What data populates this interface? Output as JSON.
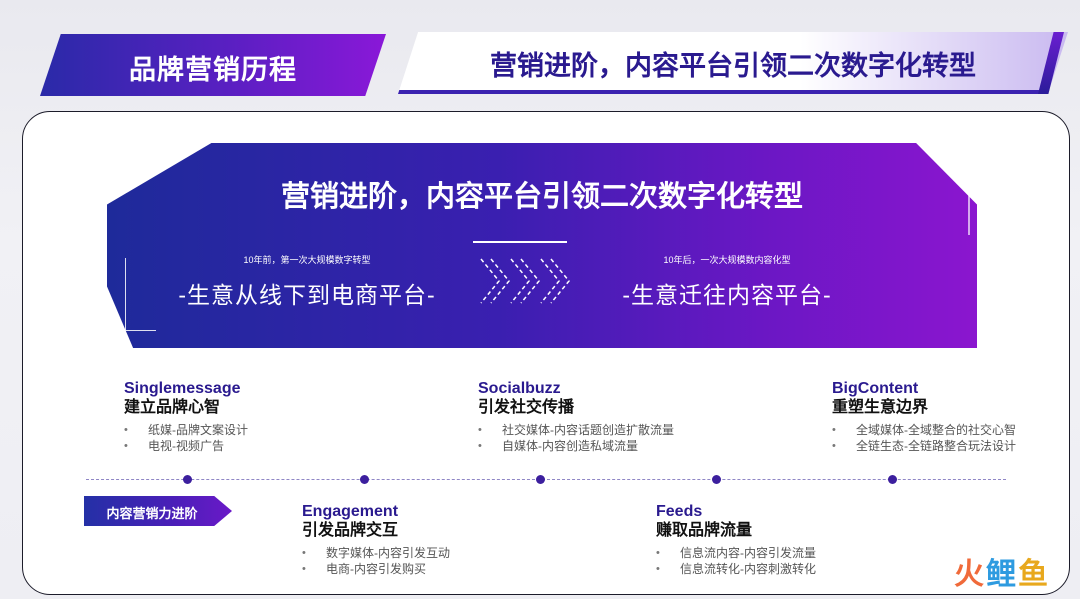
{
  "header": {
    "left_title": "品牌营销历程",
    "right_title": "营销进阶，内容平台引领二次数字化转型"
  },
  "hero": {
    "title": "营销进阶，内容平台引领二次数字化转型",
    "left_caption": "10年前，第一次大规模数字转型",
    "left_text": "-生意从线下到电商平台-",
    "right_caption": "10年后，一次大规模数内容化型",
    "right_text": "-生意迁往内容平台-"
  },
  "stages_top": [
    {
      "en": "Singlemessage",
      "zh": "建立品牌心智",
      "bullets": [
        "纸媒-品牌文案设计",
        "电视-视频广告"
      ]
    },
    {
      "en": "Socialbuzz",
      "zh": "引发社交传播",
      "bullets": [
        "社交媒体-内容话题创造扩散流量",
        "自媒体-内容创造私域流量"
      ]
    },
    {
      "en": "BigContent",
      "zh": "重塑生意边界",
      "bullets": [
        "全域媒体-全域整合的社交心智",
        "全链生态-全链路整合玩法设计"
      ]
    }
  ],
  "stages_bottom": [
    {
      "en": "Engagement",
      "zh": "引发品牌交互",
      "bullets": [
        "数字媒体-内容引发互动",
        "电商-内容引发购买"
      ]
    },
    {
      "en": "Feeds",
      "zh": "赚取品牌流量",
      "bullets": [
        "信息流内容-内容引发流量",
        "信息流转化-内容刺激转化"
      ]
    }
  ],
  "tag_label": "内容营销力进阶",
  "logo": {
    "p1": "火",
    "p2": "鲤",
    "p3": "鱼"
  },
  "colors": {
    "brand_purple": "#3c1f9e",
    "accent": "#8a18d8"
  }
}
